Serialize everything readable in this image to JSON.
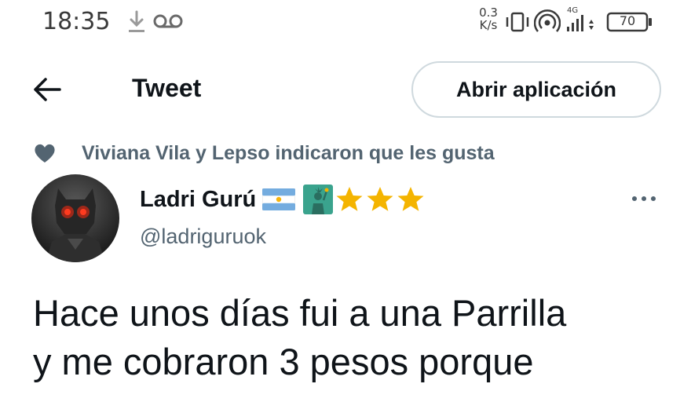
{
  "status_bar": {
    "time": "18:35",
    "network_speed_value": "0.3",
    "network_speed_unit": "K/s",
    "network_type": "4G",
    "battery_level": "70",
    "icons": [
      "download-icon",
      "voicemail-icon",
      "vibrate-icon",
      "hotspot-icon",
      "signal-icon",
      "battery-icon"
    ]
  },
  "header": {
    "title": "Tweet",
    "open_app_label": "Abrir aplicación",
    "back_icon": "back-arrow-icon"
  },
  "social_context": {
    "icon": "heart-icon",
    "text": "Viviana Vila y Lepso indicaron que les gusta"
  },
  "author": {
    "name": "Ladri Gurú",
    "handle": "@ladriguruok",
    "name_emojis": [
      "argentina-flag-icon",
      "statue-of-liberty-icon",
      "star-icon",
      "star-icon",
      "star-icon"
    ],
    "more_icon": "more-options-icon"
  },
  "tweet": {
    "lines": [
      "Hace unos días fui a una Parrilla",
      "y me cobraron 3 pesos porque"
    ]
  },
  "colors": {
    "text_primary": "#0f1419",
    "text_secondary": "#536471",
    "border": "#cfd9de",
    "star": "#f4b400",
    "flag_blue": "#74acdf",
    "liberty_green": "#3aa38d"
  }
}
